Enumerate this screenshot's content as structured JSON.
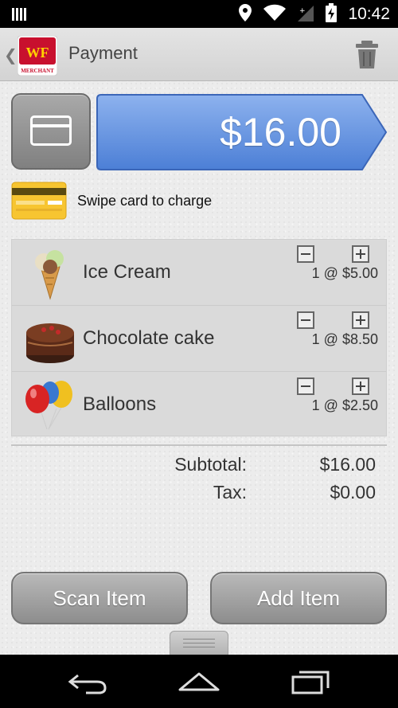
{
  "status_bar": {
    "time": "10:42",
    "icons": [
      "signal-bars-icon",
      "location-icon",
      "wifi-icon",
      "sim-icon",
      "battery-charging-icon"
    ]
  },
  "action_bar": {
    "title": "Payment",
    "logo_text": "WF",
    "logo_subtext": "MERCHANT",
    "icons": [
      "back-chevron-icon",
      "trash-icon"
    ]
  },
  "charge": {
    "amount": "$16.00",
    "accent_color": "#5b8de0"
  },
  "swipe": {
    "text": "Swipe card to charge"
  },
  "items": [
    {
      "name": "Ice Cream",
      "qty_price": "1 @ $5.00",
      "icon": "ice-cream-icon"
    },
    {
      "name": "Chocolate cake",
      "qty_price": "1 @ $8.50",
      "icon": "chocolate-cake-icon"
    },
    {
      "name": "Balloons",
      "qty_price": "1 @ $2.50",
      "icon": "balloons-icon"
    }
  ],
  "totals": {
    "subtotal_label": "Subtotal:",
    "subtotal_value": "$16.00",
    "tax_label": "Tax:",
    "tax_value": "$0.00"
  },
  "buttons": {
    "scan": "Scan Item",
    "add": "Add Item"
  },
  "nav_bar": {
    "icons": [
      "back-icon",
      "home-icon",
      "recent-apps-icon"
    ]
  }
}
